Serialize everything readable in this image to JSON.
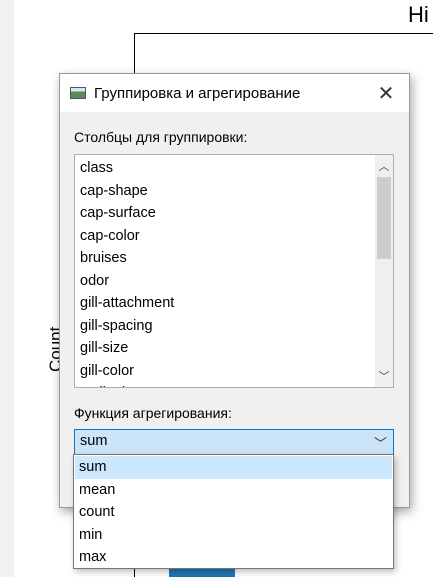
{
  "background": {
    "chart_title_fragment": "Hi",
    "y_axis_label_fragment": "Count"
  },
  "dialog": {
    "title": "Группировка и агрегирование",
    "close_icon": "close-icon",
    "group_label": "Столбцы для группировки:",
    "group_columns": [
      "class",
      "cap-shape",
      "cap-surface",
      "cap-color",
      "bruises",
      "odor",
      "gill-attachment",
      "gill-spacing",
      "gill-size",
      "gill-color",
      "stalk-shape"
    ],
    "agg_label": "Функция агрегирования:",
    "agg_selected": "sum",
    "agg_options": [
      "sum",
      "mean",
      "count",
      "min",
      "max"
    ]
  },
  "colors": {
    "accent": "#0078d7",
    "selection": "#cce8ff",
    "bar": "#1f77b4"
  }
}
